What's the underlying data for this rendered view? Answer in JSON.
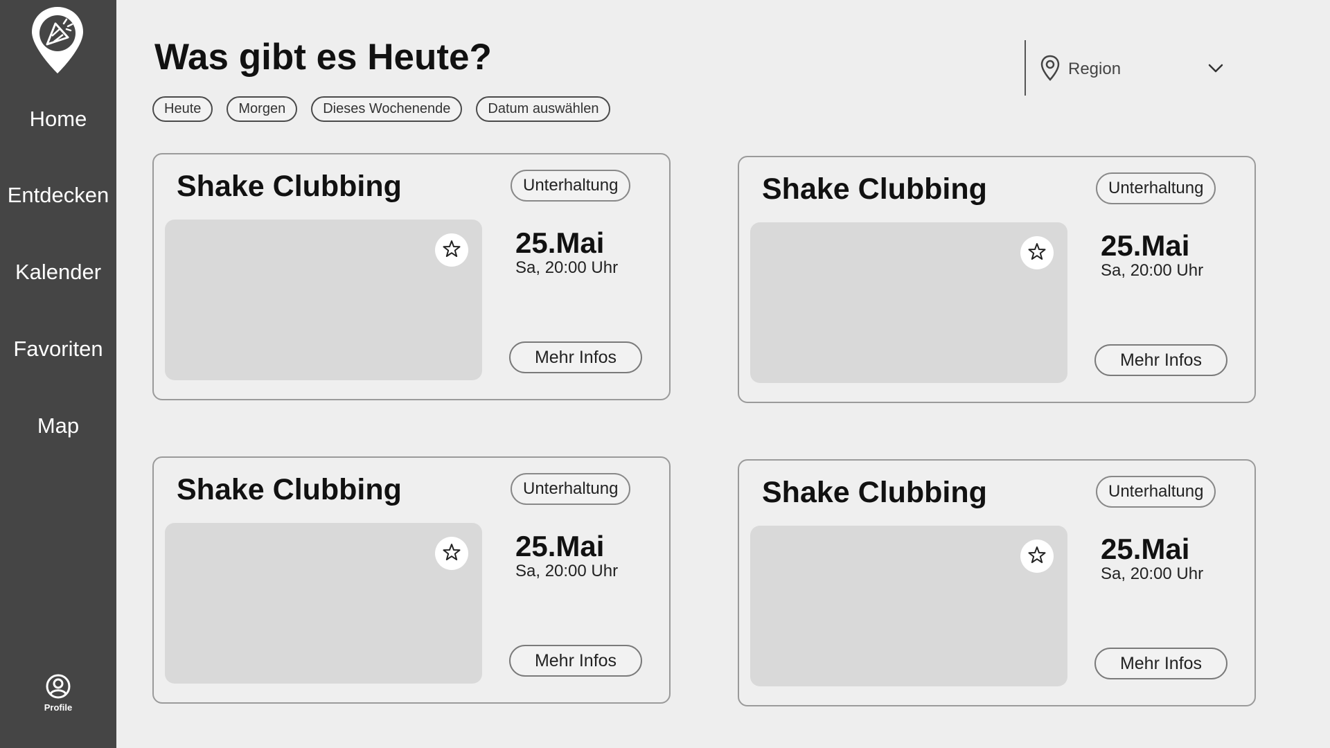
{
  "sidebar": {
    "logo_icon": "location-pin-party-icon",
    "items": [
      {
        "label": "Home"
      },
      {
        "label": "Entdecken"
      },
      {
        "label": "Kalender"
      },
      {
        "label": "Favoriten"
      },
      {
        "label": "Map"
      }
    ],
    "profile": {
      "icon": "user-circle-icon",
      "label": "Profile"
    }
  },
  "header": {
    "title": "Was gibt es Heute?",
    "filters": [
      {
        "label": "Heute"
      },
      {
        "label": "Morgen"
      },
      {
        "label": "Dieses Wochenende"
      },
      {
        "label": "Datum auswählen"
      }
    ],
    "region": {
      "icon": "map-pin-icon",
      "label": "Region",
      "dropdown_icon": "chevron-down-icon"
    }
  },
  "events": [
    {
      "title": "Shake Clubbing",
      "category": "Unterhaltung",
      "date": "25.Mai",
      "time": "Sa, 20:00 Uhr",
      "button": "Mehr Infos",
      "favorite_icon": "star-outline-icon"
    },
    {
      "title": "Shake Clubbing",
      "category": "Unterhaltung",
      "date": "25.Mai",
      "time": "Sa, 20:00 Uhr",
      "button": "Mehr Infos",
      "favorite_icon": "star-outline-icon"
    },
    {
      "title": "Shake Clubbing",
      "category": "Unterhaltung",
      "date": "25.Mai",
      "time": "Sa, 20:00 Uhr",
      "button": "Mehr Infos",
      "favorite_icon": "star-outline-icon"
    },
    {
      "title": "Shake Clubbing",
      "category": "Unterhaltung",
      "date": "25.Mai",
      "time": "Sa, 20:00 Uhr",
      "button": "Mehr Infos",
      "favorite_icon": "star-outline-icon"
    }
  ],
  "colors": {
    "sidebar_bg": "#454545",
    "page_bg": "#eeeeee",
    "image_placeholder": "#d9d9d9"
  }
}
